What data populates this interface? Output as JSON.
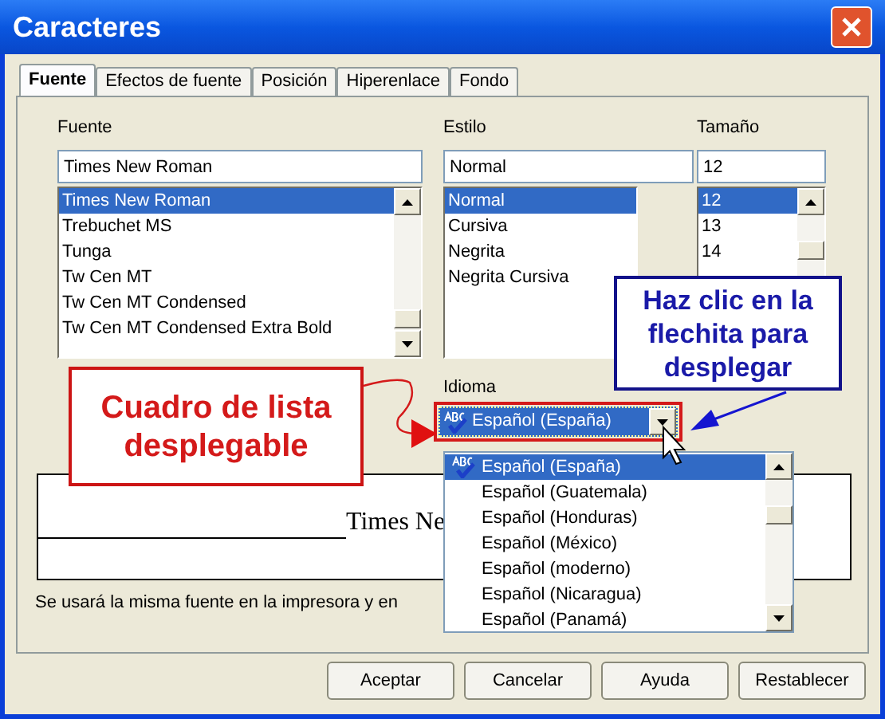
{
  "window": {
    "title": "Caracteres"
  },
  "tabs": [
    {
      "label": "Fuente",
      "selected": true
    },
    {
      "label": "Efectos de fuente",
      "selected": false
    },
    {
      "label": "Posición",
      "selected": false
    },
    {
      "label": "Hiperenlace",
      "selected": false
    },
    {
      "label": "Fondo",
      "selected": false
    }
  ],
  "font": {
    "label": "Fuente",
    "value": "Times New Roman",
    "items": [
      {
        "text": "Times New Roman",
        "selected": true
      },
      {
        "text": "Trebuchet MS",
        "selected": false
      },
      {
        "text": "Tunga",
        "selected": false
      },
      {
        "text": "Tw Cen MT",
        "selected": false
      },
      {
        "text": "Tw Cen MT Condensed",
        "selected": false
      },
      {
        "text": "Tw Cen MT Condensed Extra Bold",
        "selected": false
      }
    ]
  },
  "style": {
    "label": "Estilo",
    "value": "Normal",
    "items": [
      {
        "text": "Normal",
        "selected": true
      },
      {
        "text": "Cursiva",
        "selected": false
      },
      {
        "text": "Negrita",
        "selected": false
      },
      {
        "text": "Negrita Cursiva",
        "selected": false
      }
    ]
  },
  "size": {
    "label": "Tamaño",
    "value": "12",
    "items": [
      {
        "text": "12",
        "selected": true
      },
      {
        "text": "13",
        "selected": false
      },
      {
        "text": "14",
        "selected": false
      }
    ]
  },
  "language": {
    "label": "Idioma",
    "value": "Español (España)",
    "options": [
      {
        "text": "Español (España)",
        "selected": true,
        "spellcheck": true
      },
      {
        "text": "Español (Guatemala)",
        "selected": false,
        "spellcheck": false
      },
      {
        "text": "Español (Honduras)",
        "selected": false,
        "spellcheck": false
      },
      {
        "text": "Español (México)",
        "selected": false,
        "spellcheck": false
      },
      {
        "text": "Español (moderno)",
        "selected": false,
        "spellcheck": false
      },
      {
        "text": "Español (Nicaragua)",
        "selected": false,
        "spellcheck": false
      },
      {
        "text": "Español (Panamá)",
        "selected": false,
        "spellcheck": false
      }
    ]
  },
  "preview": {
    "text": "Times Ne"
  },
  "note": "Se usará la misma fuente en la impresora y en",
  "callouts": [
    {
      "kind": "red",
      "text": "Cuadro de lista desplegable"
    },
    {
      "kind": "blue",
      "text": "Haz clic en la flechita para desplegar"
    }
  ],
  "buttons": [
    "Aceptar",
    "Cancelar",
    "Ayuda",
    "Restablecer"
  ]
}
